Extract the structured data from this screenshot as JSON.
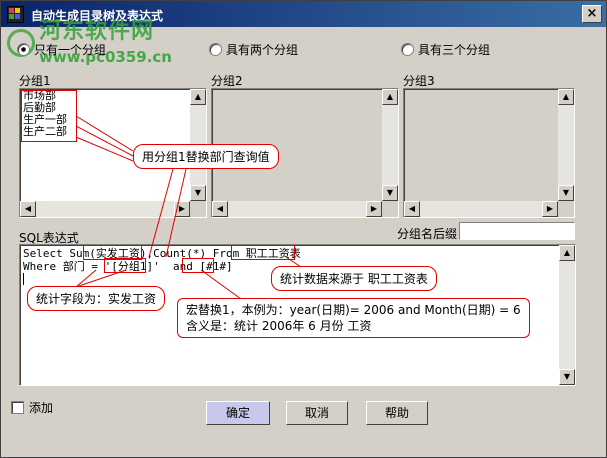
{
  "window": {
    "title": "自动生成目录树及表达式",
    "close_glyph": "×"
  },
  "watermark": {
    "name": "河东软件网",
    "url": "www.pc0359.cn"
  },
  "radios": [
    {
      "label": "只有一个分组",
      "selected": true
    },
    {
      "label": "具有两个分组",
      "selected": false
    },
    {
      "label": "具有三个分组",
      "selected": false
    }
  ],
  "groups": [
    {
      "label": "分组1",
      "items": [
        "市场部",
        "后勤部",
        "生产一部",
        "生产二部"
      ]
    },
    {
      "label": "分组2",
      "items": []
    },
    {
      "label": "分组3",
      "items": []
    }
  ],
  "sql_label": "SQL表达式",
  "suffix_label": "分组名后缀",
  "suffix_value": "",
  "sql_lines": [
    "Select Sum(实发工资),Count(*) From 职工工资表",
    "Where 部门 = '[分组1]'  and [#1#]"
  ],
  "callouts": {
    "group_query": "用分组1替换部门查询值",
    "source": "统计数据来源于 职工工资表",
    "field": "统计字段为：实发工资",
    "macro_line1": "宏替换1，本例为：year(日期)=  2006   and Month(日期) = 6",
    "macro_line2": "含义是：统计 2006年 6 月份 工资"
  },
  "checkbox_label": "添加",
  "buttons": {
    "ok": "确定",
    "cancel": "取消",
    "help": "帮助"
  },
  "colors": {
    "titlebar": "#0a246a",
    "annotation": "#e00000",
    "dialog": "#d4d0c8",
    "watermark": "#36a33a"
  }
}
